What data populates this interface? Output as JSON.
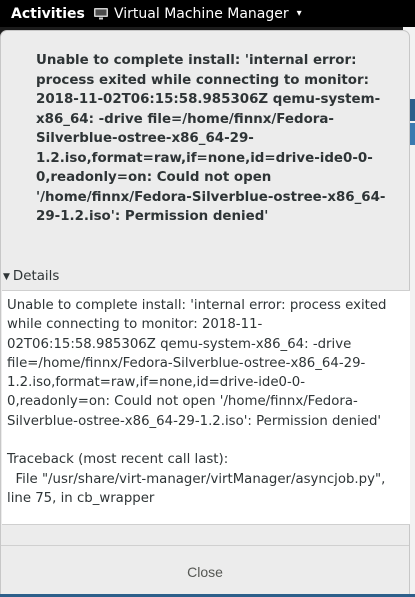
{
  "topbar": {
    "activities_label": "Activities",
    "app_name": "Virtual Machine Manager",
    "app_icon": "virt-manager-icon",
    "menu_caret": "▾"
  },
  "dialog": {
    "primary_text": "Unable to complete install: 'internal error: process exited while connecting to monitor: 2018-11-02T06:15:58.985306Z qemu-system-x86_64: -drive file=/home/finnx/Fedora-Silverblue-ostree-x86_64-29-1.2.iso,format=raw,if=none,id=drive-ide0-0-0,readonly=on: Could not open '/home/finnx/Fedora-Silverblue-ostree-x86_64-29-1.2.iso': Permission denied'",
    "details_label": "Details",
    "details_expanded": true,
    "details_text": "Unable to complete install: 'internal error: process exited while connecting to monitor: 2018-11-02T06:15:58.985306Z qemu-system-x86_64: -drive file=/home/finnx/Fedora-Silverblue-ostree-x86_64-29-1.2.iso,format=raw,if=none,id=drive-ide0-0-0,readonly=on: Could not open '/home/finnx/Fedora-Silverblue-ostree-x86_64-29-1.2.iso': Permission denied'\n\nTraceback (most recent call last):\n  File \"/usr/share/virt-manager/virtManager/asyncjob.py\", line 75, in cb_wrapper",
    "close_label": "Close"
  },
  "colors": {
    "topbar_bg": "#000000",
    "dialog_bg": "#ececec",
    "text": "#2e3436",
    "accent": "#2d5f8a"
  }
}
